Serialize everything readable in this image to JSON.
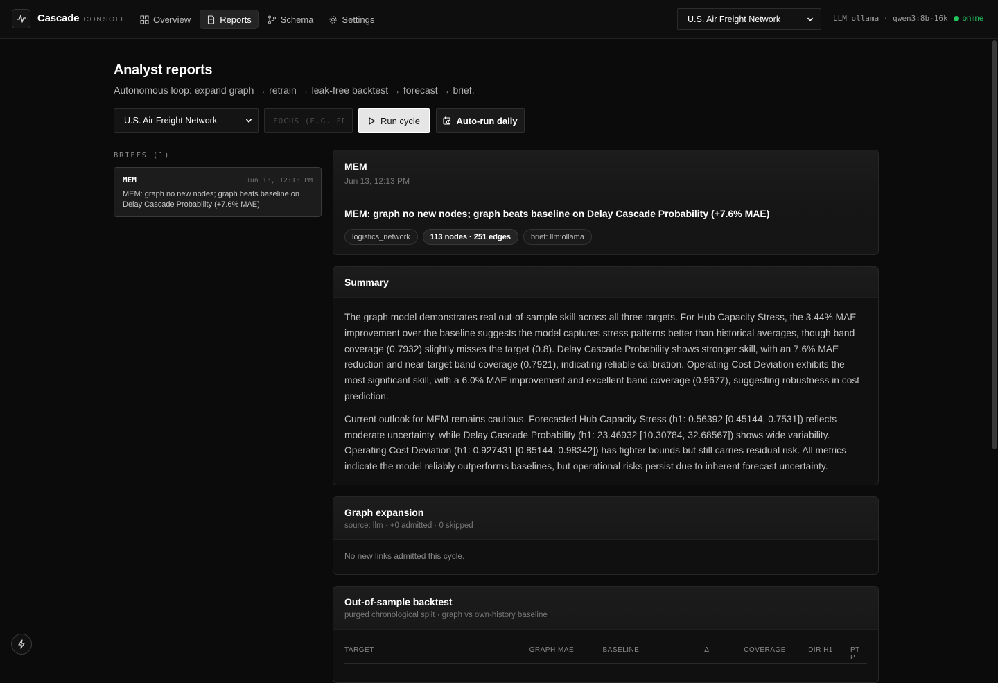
{
  "app": {
    "name": "Cascade",
    "subtitle": "CONSOLE"
  },
  "nav": [
    {
      "label": "Overview",
      "icon": "grid-icon",
      "active": false
    },
    {
      "label": "Reports",
      "icon": "document-icon",
      "active": true
    },
    {
      "label": "Schema",
      "icon": "git-branch-icon",
      "active": false
    },
    {
      "label": "Settings",
      "icon": "gear-icon",
      "active": false
    }
  ],
  "header": {
    "network_select": "U.S. Air Freight Network",
    "llm_label": "LLM ollama · qwen3:8b-16k",
    "status": "online"
  },
  "page": {
    "title": "Analyst reports",
    "subtitle": "Autonomous loop: expand graph → retrain → leak-free backtest → forecast → brief."
  },
  "controls": {
    "network_select": "U.S. Air Freight Network",
    "focus_placeholder": "FOCUS (E.G. FD",
    "run_label": "Run cycle",
    "auto_label": "Auto-run daily"
  },
  "briefs": {
    "label": "BRIEFS (1)",
    "items": [
      {
        "code": "MEM",
        "date": "Jun 13, 12:13 PM",
        "text": "MEM: graph no new nodes; graph beats baseline on Delay Cascade Probability (+7.6% MAE)"
      }
    ]
  },
  "report": {
    "code": "MEM",
    "date": "Jun 13, 12:13 PM",
    "headline": "MEM: graph no new nodes; graph beats baseline on Delay Cascade Probability (+7.6% MAE)",
    "tags": [
      "logistics_network",
      "113 nodes · 251 edges",
      "brief: llm:ollama"
    ]
  },
  "summary": {
    "title": "Summary",
    "paragraphs": [
      "The graph model demonstrates real out-of-sample skill across all three targets. For Hub Capacity Stress, the 3.44% MAE improvement over the baseline suggests the model captures stress patterns better than historical averages, though band coverage (0.7932) slightly misses the target (0.8). Delay Cascade Probability shows stronger skill, with an 7.6% MAE reduction and near-target band coverage (0.7921), indicating reliable calibration. Operating Cost Deviation exhibits the most significant skill, with a 6.0% MAE improvement and excellent band coverage (0.9677), suggesting robustness in cost prediction.",
      "Current outlook for MEM remains cautious. Forecasted Hub Capacity Stress (h1: 0.56392 [0.45144, 0.7531]) reflects moderate uncertainty, while Delay Cascade Probability (h1: 23.46932 [10.30784, 32.68567]) shows wide variability. Operating Cost Deviation (h1: 0.927431 [0.85144, 0.98342]) has tighter bounds but still carries residual risk. All metrics indicate the model reliably outperforms baselines, but operational risks persist due to inherent forecast uncertainty."
    ]
  },
  "expansion": {
    "title": "Graph expansion",
    "meta": "source: llm · +0 admitted · 0 skipped",
    "body": "No new links admitted this cycle."
  },
  "backtest": {
    "title": "Out-of-sample backtest",
    "meta": "purged chronological split · graph vs own-history baseline",
    "columns": [
      "TARGET",
      "GRAPH MAE",
      "BASELINE",
      "Δ",
      "COVERAGE",
      "DIR H1",
      "PT P"
    ]
  }
}
